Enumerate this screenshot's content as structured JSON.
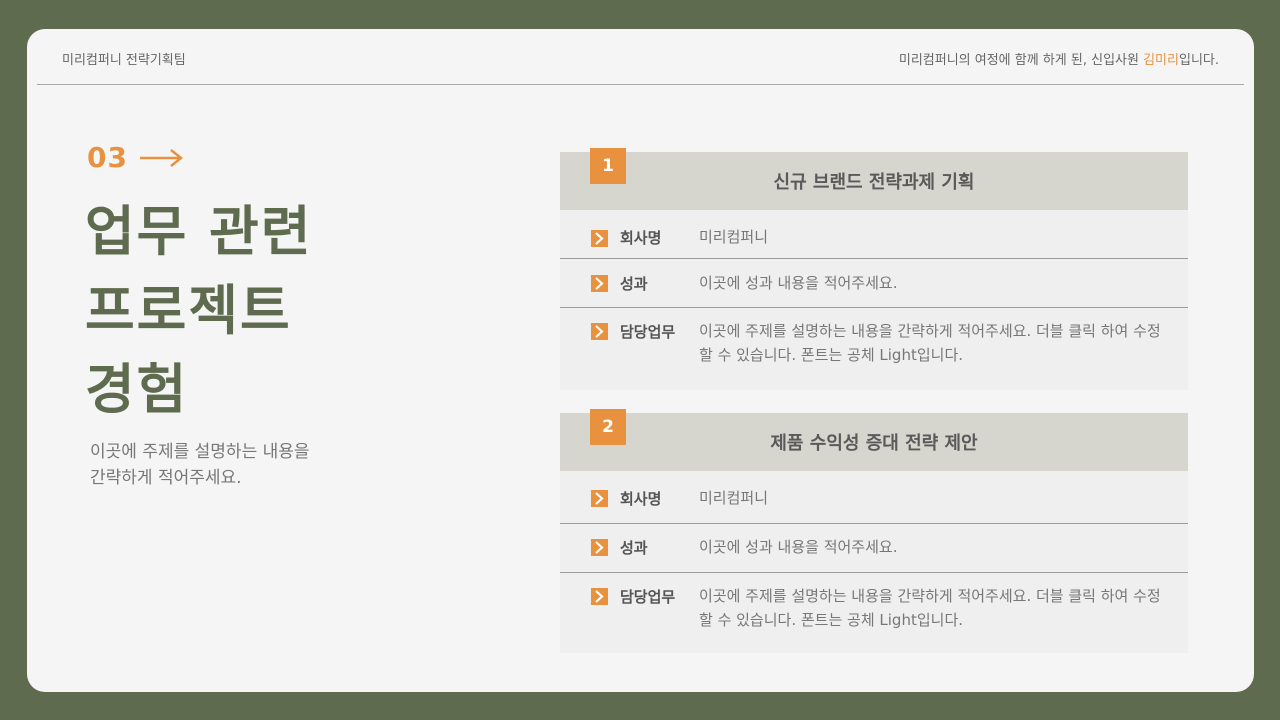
{
  "header": {
    "left": "미리컴퍼니 전략기획팀",
    "right_prefix": "미리컴퍼니의 여정에 함께 하게 된, 신입사원 ",
    "right_highlight": "김미리",
    "right_suffix": "입니다."
  },
  "section": {
    "number": "03",
    "title_lines": [
      "업무 관련",
      "프로젝트",
      "경험"
    ],
    "desc_lines": [
      "이곳에 주제를 설명하는 내용을",
      "간략하게 적어주세요."
    ]
  },
  "projects": [
    {
      "badge": "1",
      "title": "신규 브랜드 전략과제 기획",
      "rows": [
        {
          "label": "회사명",
          "value": "미리컴퍼니"
        },
        {
          "label": "성과",
          "value": "이곳에 성과 내용을 적어주세요."
        },
        {
          "label": "담당업무",
          "value": "이곳에 주제를 설명하는 내용을 간략하게 적어주세요. 더블 클릭 하여 수정할 수 있습니다. 폰트는 공체 Light입니다."
        }
      ]
    },
    {
      "badge": "2",
      "title": "제품 수익성 증대 전략 제안",
      "rows": [
        {
          "label": "회사명",
          "value": "미리컴퍼니"
        },
        {
          "label": "성과",
          "value": "이곳에 성과 내용을 적어주세요."
        },
        {
          "label": "담당업무",
          "value": "이곳에 주제를 설명하는 내용을 간략하게 적어주세요. 더블 클릭 하여 수정할 수 있습니다. 폰트는 공체 Light입니다."
        }
      ]
    }
  ],
  "colors": {
    "frame": "#5f6b4f",
    "accent": "#e8923f",
    "panel_header": "#d6d5ce",
    "panel_body": "#efefef"
  },
  "icons": [
    "arrow-right-icon",
    "chevron-right-icon"
  ]
}
